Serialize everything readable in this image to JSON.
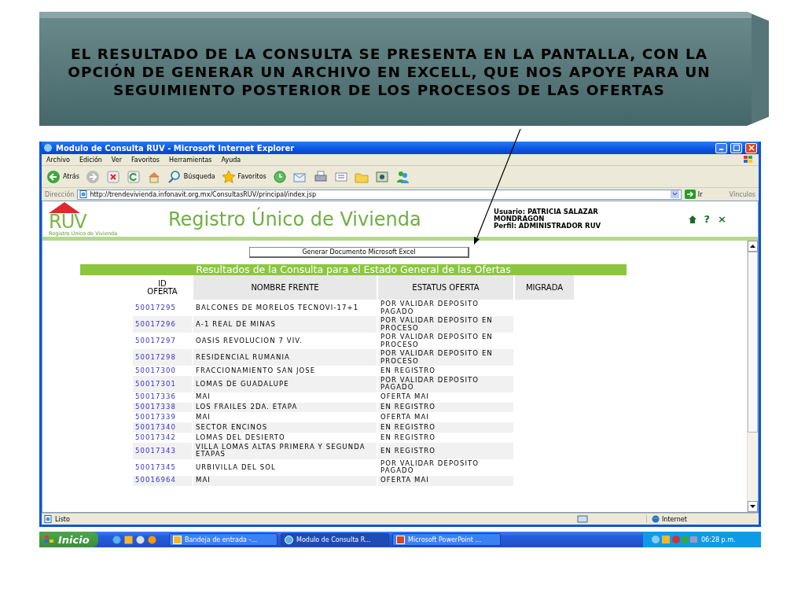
{
  "banner": {
    "text": "EL RESULTADO DE LA CONSULTA SE PRESENTA EN LA PANTALLA, CON LA OPCIÓN DE GENERAR UN ARCHIVO EN EXCELL, QUE NOS APOYE PARA UN SEGUIMIENTO POSTERIOR DE LOS PROCESOS DE LAS OFERTAS"
  },
  "window": {
    "title": "Modulo de Consulta RUV - Microsoft Internet Explorer",
    "menu": [
      "Archivo",
      "Edición",
      "Ver",
      "Favoritos",
      "Herramientas",
      "Ayuda"
    ],
    "toolbar": [
      {
        "kind": "back",
        "label": "Atrás"
      },
      {
        "kind": "forward"
      },
      {
        "kind": "stop"
      },
      {
        "kind": "refresh"
      },
      {
        "kind": "home"
      },
      {
        "kind": "search",
        "label": "Búsqueda"
      },
      {
        "kind": "favorites",
        "label": "Favoritos"
      },
      {
        "kind": "history"
      },
      {
        "kind": "mail"
      },
      {
        "kind": "print"
      },
      {
        "kind": "edit"
      },
      {
        "kind": "folder"
      },
      {
        "kind": "media"
      },
      {
        "kind": "messenger"
      }
    ],
    "address": {
      "label": "Dirección",
      "url": "http://trendevivienda.infonavit.org.mx/ConsultasRUV/principal/index.jsp",
      "go": "Ir",
      "links": "Vínculos"
    }
  },
  "page": {
    "logo": "RUV",
    "logo_caption": "Registro Único de Vivienda",
    "title": "Registro Único de Vivienda",
    "user": [
      "Usuario: PATRICIA SALAZAR",
      "MONDRAGON",
      "Perfil: ADMINISTRADOR RUV"
    ],
    "help": "?",
    "close": "×",
    "excel_button": "Generar Documento Microsoft Excel",
    "table_title": "Resultados de la Consulta para el Estado General de las Ofertas",
    "columns": [
      "ID OFERTA",
      "NOMBRE FRENTE",
      "ESTATUS OFERTA",
      "MIGRADA"
    ],
    "rows": [
      {
        "id": "50017295",
        "name": "BALCONES DE MORELOS TECNOVI-17+1",
        "status": "POR VALIDAR DEPOSITO PAGADO"
      },
      {
        "id": "50017296",
        "name": "A-1 REAL DE MINAS",
        "status": "POR VALIDAR DEPOSITO EN PROCESO"
      },
      {
        "id": "50017297",
        "name": "OASIS REVOLUCION 7 VIV.",
        "status": "POR VALIDAR DEPOSITO EN PROCESO"
      },
      {
        "id": "50017298",
        "name": "RESIDENCIAL RUMANIA",
        "status": "POR VALIDAR DEPOSITO EN PROCESO"
      },
      {
        "id": "50017300",
        "name": "FRACCIONAMIENTO SAN JOSE",
        "status": "EN REGISTRO"
      },
      {
        "id": "50017301",
        "name": "LOMAS DE GUADALUPE",
        "status": "POR VALIDAR DEPOSITO PAGADO"
      },
      {
        "id": "50017336",
        "name": "MAI",
        "status": "OFERTA MAI"
      },
      {
        "id": "50017338",
        "name": "LOS FRAILES 2DA. ETAPA",
        "status": "EN REGISTRO"
      },
      {
        "id": "50017339",
        "name": "MAI",
        "status": "OFERTA MAI"
      },
      {
        "id": "50017340",
        "name": "SECTOR ENCINOS",
        "status": "EN REGISTRO"
      },
      {
        "id": "50017342",
        "name": "LOMAS DEL DESIERTO",
        "status": "EN REGISTRO"
      },
      {
        "id": "50017343",
        "name": "VILLA LOMAS ALTAS PRIMERA Y SEGUNDA ETAPAS",
        "status": "EN REGISTRO"
      },
      {
        "id": "50017345",
        "name": "URBIVILLA DEL SOL",
        "status": "POR VALIDAR DEPOSITO PAGADO"
      },
      {
        "id": "50016964",
        "name": "MAI",
        "status": "OFERTA MAI"
      }
    ]
  },
  "status_bar": {
    "text": "Listo",
    "zone": "Internet"
  },
  "taskbar": {
    "start": "Inicio",
    "tasks": [
      {
        "label": "Bandeja de entrada -...",
        "kind": "outlook",
        "selected": false
      },
      {
        "label": "Modulo de Consulta R...",
        "kind": "ie",
        "selected": true
      },
      {
        "label": "Microsoft PowerPoint ...",
        "kind": "powerpoint",
        "selected": false
      }
    ],
    "clock": "06:28 p.m."
  }
}
